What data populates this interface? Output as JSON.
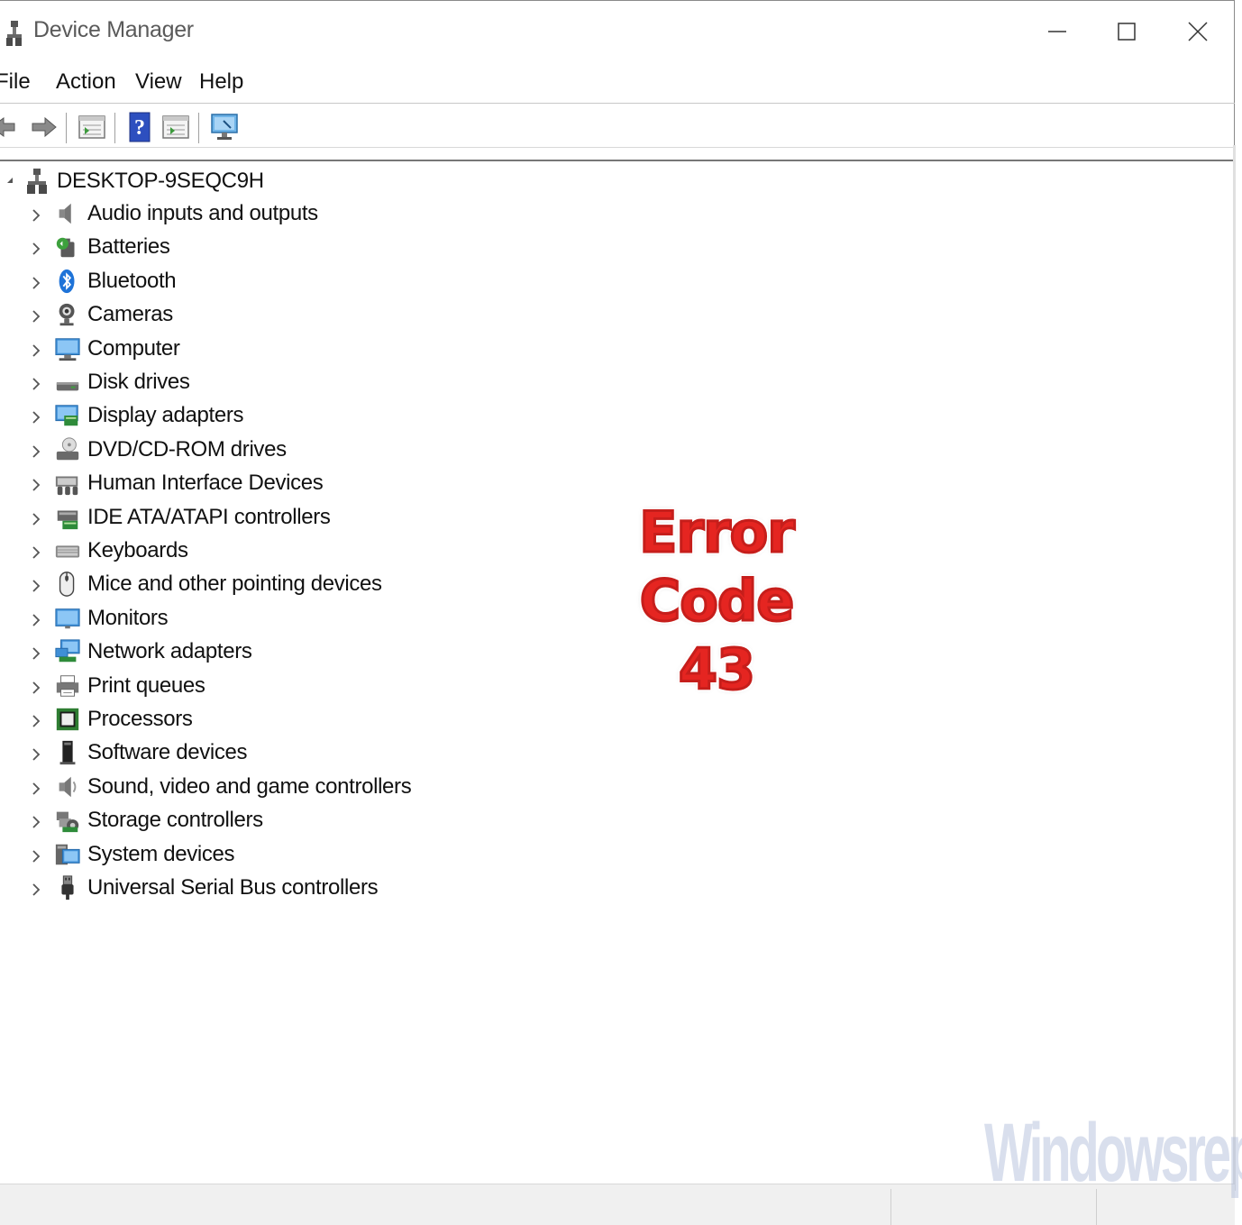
{
  "window": {
    "title": "Device Manager",
    "controls": [
      "minimize",
      "maximize",
      "close"
    ]
  },
  "menu": {
    "items": [
      "File",
      "Action",
      "View",
      "Help"
    ]
  },
  "toolbar": {
    "buttons": [
      "back-icon",
      "forward-icon",
      "properties-icon",
      "help-icon",
      "update-driver-icon",
      "scan-hardware-icon"
    ]
  },
  "tree": {
    "root": "DESKTOP-9SEQC9H",
    "items": [
      {
        "label": "Audio inputs and outputs",
        "icon": "speaker-icon"
      },
      {
        "label": "Batteries",
        "icon": "battery-icon"
      },
      {
        "label": "Bluetooth",
        "icon": "bluetooth-icon"
      },
      {
        "label": "Cameras",
        "icon": "camera-icon"
      },
      {
        "label": "Computer",
        "icon": "computer-icon"
      },
      {
        "label": "Disk drives",
        "icon": "disk-drive-icon"
      },
      {
        "label": "Display adapters",
        "icon": "display-adapter-icon"
      },
      {
        "label": "DVD/CD-ROM drives",
        "icon": "dvd-drive-icon"
      },
      {
        "label": "Human Interface Devices",
        "icon": "hid-icon"
      },
      {
        "label": "IDE ATA/ATAPI controllers",
        "icon": "ide-controller-icon"
      },
      {
        "label": "Keyboards",
        "icon": "keyboard-icon"
      },
      {
        "label": "Mice and other pointing devices",
        "icon": "mouse-icon"
      },
      {
        "label": "Monitors",
        "icon": "monitor-icon"
      },
      {
        "label": "Network adapters",
        "icon": "network-adapter-icon"
      },
      {
        "label": "Print queues",
        "icon": "printer-icon"
      },
      {
        "label": "Processors",
        "icon": "processor-icon"
      },
      {
        "label": "Software devices",
        "icon": "software-device-icon"
      },
      {
        "label": "Sound, video and game controllers",
        "icon": "sound-controller-icon"
      },
      {
        "label": "Storage controllers",
        "icon": "storage-controller-icon"
      },
      {
        "label": "System devices",
        "icon": "system-devices-icon"
      },
      {
        "label": "Universal Serial Bus controllers",
        "icon": "usb-icon"
      }
    ]
  },
  "overlay": {
    "line1": "Error",
    "line2": "Code 43",
    "color": "#e52521"
  },
  "watermark": {
    "text": "Windowsreport"
  }
}
